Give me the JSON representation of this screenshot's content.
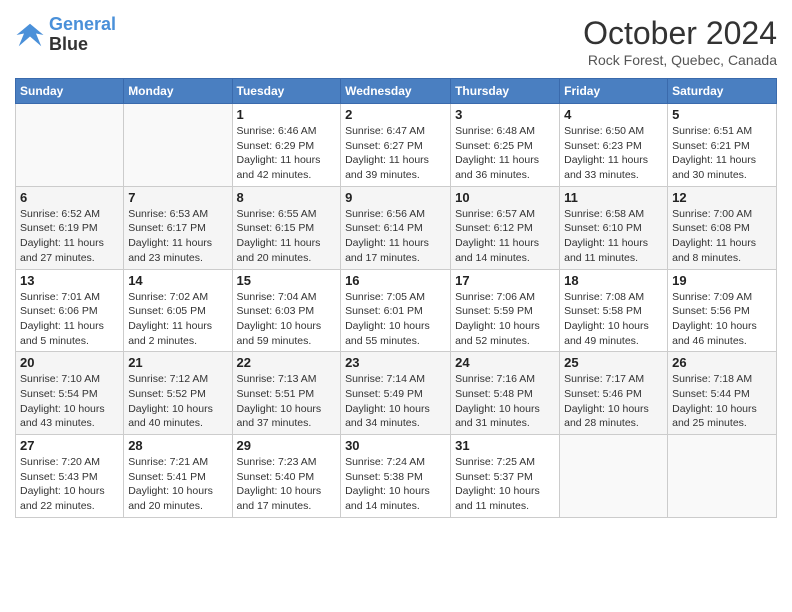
{
  "header": {
    "logo_line1": "General",
    "logo_line2": "Blue",
    "month_title": "October 2024",
    "location": "Rock Forest, Quebec, Canada"
  },
  "columns": [
    "Sunday",
    "Monday",
    "Tuesday",
    "Wednesday",
    "Thursday",
    "Friday",
    "Saturday"
  ],
  "weeks": [
    [
      {
        "day": "",
        "info": ""
      },
      {
        "day": "",
        "info": ""
      },
      {
        "day": "1",
        "info": "Sunrise: 6:46 AM\nSunset: 6:29 PM\nDaylight: 11 hours and 42 minutes."
      },
      {
        "day": "2",
        "info": "Sunrise: 6:47 AM\nSunset: 6:27 PM\nDaylight: 11 hours and 39 minutes."
      },
      {
        "day": "3",
        "info": "Sunrise: 6:48 AM\nSunset: 6:25 PM\nDaylight: 11 hours and 36 minutes."
      },
      {
        "day": "4",
        "info": "Sunrise: 6:50 AM\nSunset: 6:23 PM\nDaylight: 11 hours and 33 minutes."
      },
      {
        "day": "5",
        "info": "Sunrise: 6:51 AM\nSunset: 6:21 PM\nDaylight: 11 hours and 30 minutes."
      }
    ],
    [
      {
        "day": "6",
        "info": "Sunrise: 6:52 AM\nSunset: 6:19 PM\nDaylight: 11 hours and 27 minutes."
      },
      {
        "day": "7",
        "info": "Sunrise: 6:53 AM\nSunset: 6:17 PM\nDaylight: 11 hours and 23 minutes."
      },
      {
        "day": "8",
        "info": "Sunrise: 6:55 AM\nSunset: 6:15 PM\nDaylight: 11 hours and 20 minutes."
      },
      {
        "day": "9",
        "info": "Sunrise: 6:56 AM\nSunset: 6:14 PM\nDaylight: 11 hours and 17 minutes."
      },
      {
        "day": "10",
        "info": "Sunrise: 6:57 AM\nSunset: 6:12 PM\nDaylight: 11 hours and 14 minutes."
      },
      {
        "day": "11",
        "info": "Sunrise: 6:58 AM\nSunset: 6:10 PM\nDaylight: 11 hours and 11 minutes."
      },
      {
        "day": "12",
        "info": "Sunrise: 7:00 AM\nSunset: 6:08 PM\nDaylight: 11 hours and 8 minutes."
      }
    ],
    [
      {
        "day": "13",
        "info": "Sunrise: 7:01 AM\nSunset: 6:06 PM\nDaylight: 11 hours and 5 minutes."
      },
      {
        "day": "14",
        "info": "Sunrise: 7:02 AM\nSunset: 6:05 PM\nDaylight: 11 hours and 2 minutes."
      },
      {
        "day": "15",
        "info": "Sunrise: 7:04 AM\nSunset: 6:03 PM\nDaylight: 10 hours and 59 minutes."
      },
      {
        "day": "16",
        "info": "Sunrise: 7:05 AM\nSunset: 6:01 PM\nDaylight: 10 hours and 55 minutes."
      },
      {
        "day": "17",
        "info": "Sunrise: 7:06 AM\nSunset: 5:59 PM\nDaylight: 10 hours and 52 minutes."
      },
      {
        "day": "18",
        "info": "Sunrise: 7:08 AM\nSunset: 5:58 PM\nDaylight: 10 hours and 49 minutes."
      },
      {
        "day": "19",
        "info": "Sunrise: 7:09 AM\nSunset: 5:56 PM\nDaylight: 10 hours and 46 minutes."
      }
    ],
    [
      {
        "day": "20",
        "info": "Sunrise: 7:10 AM\nSunset: 5:54 PM\nDaylight: 10 hours and 43 minutes."
      },
      {
        "day": "21",
        "info": "Sunrise: 7:12 AM\nSunset: 5:52 PM\nDaylight: 10 hours and 40 minutes."
      },
      {
        "day": "22",
        "info": "Sunrise: 7:13 AM\nSunset: 5:51 PM\nDaylight: 10 hours and 37 minutes."
      },
      {
        "day": "23",
        "info": "Sunrise: 7:14 AM\nSunset: 5:49 PM\nDaylight: 10 hours and 34 minutes."
      },
      {
        "day": "24",
        "info": "Sunrise: 7:16 AM\nSunset: 5:48 PM\nDaylight: 10 hours and 31 minutes."
      },
      {
        "day": "25",
        "info": "Sunrise: 7:17 AM\nSunset: 5:46 PM\nDaylight: 10 hours and 28 minutes."
      },
      {
        "day": "26",
        "info": "Sunrise: 7:18 AM\nSunset: 5:44 PM\nDaylight: 10 hours and 25 minutes."
      }
    ],
    [
      {
        "day": "27",
        "info": "Sunrise: 7:20 AM\nSunset: 5:43 PM\nDaylight: 10 hours and 22 minutes."
      },
      {
        "day": "28",
        "info": "Sunrise: 7:21 AM\nSunset: 5:41 PM\nDaylight: 10 hours and 20 minutes."
      },
      {
        "day": "29",
        "info": "Sunrise: 7:23 AM\nSunset: 5:40 PM\nDaylight: 10 hours and 17 minutes."
      },
      {
        "day": "30",
        "info": "Sunrise: 7:24 AM\nSunset: 5:38 PM\nDaylight: 10 hours and 14 minutes."
      },
      {
        "day": "31",
        "info": "Sunrise: 7:25 AM\nSunset: 5:37 PM\nDaylight: 10 hours and 11 minutes."
      },
      {
        "day": "",
        "info": ""
      },
      {
        "day": "",
        "info": ""
      }
    ]
  ]
}
